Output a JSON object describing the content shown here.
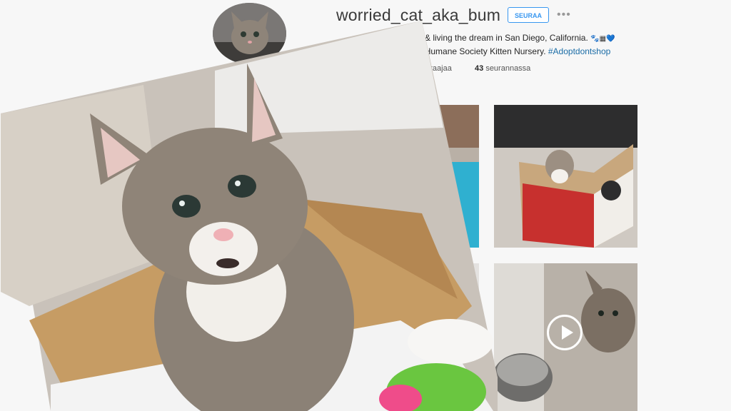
{
  "profile": {
    "username": "worried_cat_aka_bum",
    "follow_label": "SEURAA",
    "more_label": "•••",
    "bio_line1": "ved, & living the dream in San Diego, California.",
    "bio_line1_emoji": "🐾▦💙",
    "bio_line2_text": "Diego Humane Society Kitten Nursery. ",
    "bio_line2_tag": "#Adoptdontshop",
    "followers_label": "euraajaa",
    "following_count": "43",
    "following_label": "seurannassa"
  },
  "grid": {
    "video_icon": "play-icon"
  },
  "colors": {
    "accent": "#3897f0",
    "hashtag": "#1a6ca6",
    "background": "#f7f7f7"
  }
}
